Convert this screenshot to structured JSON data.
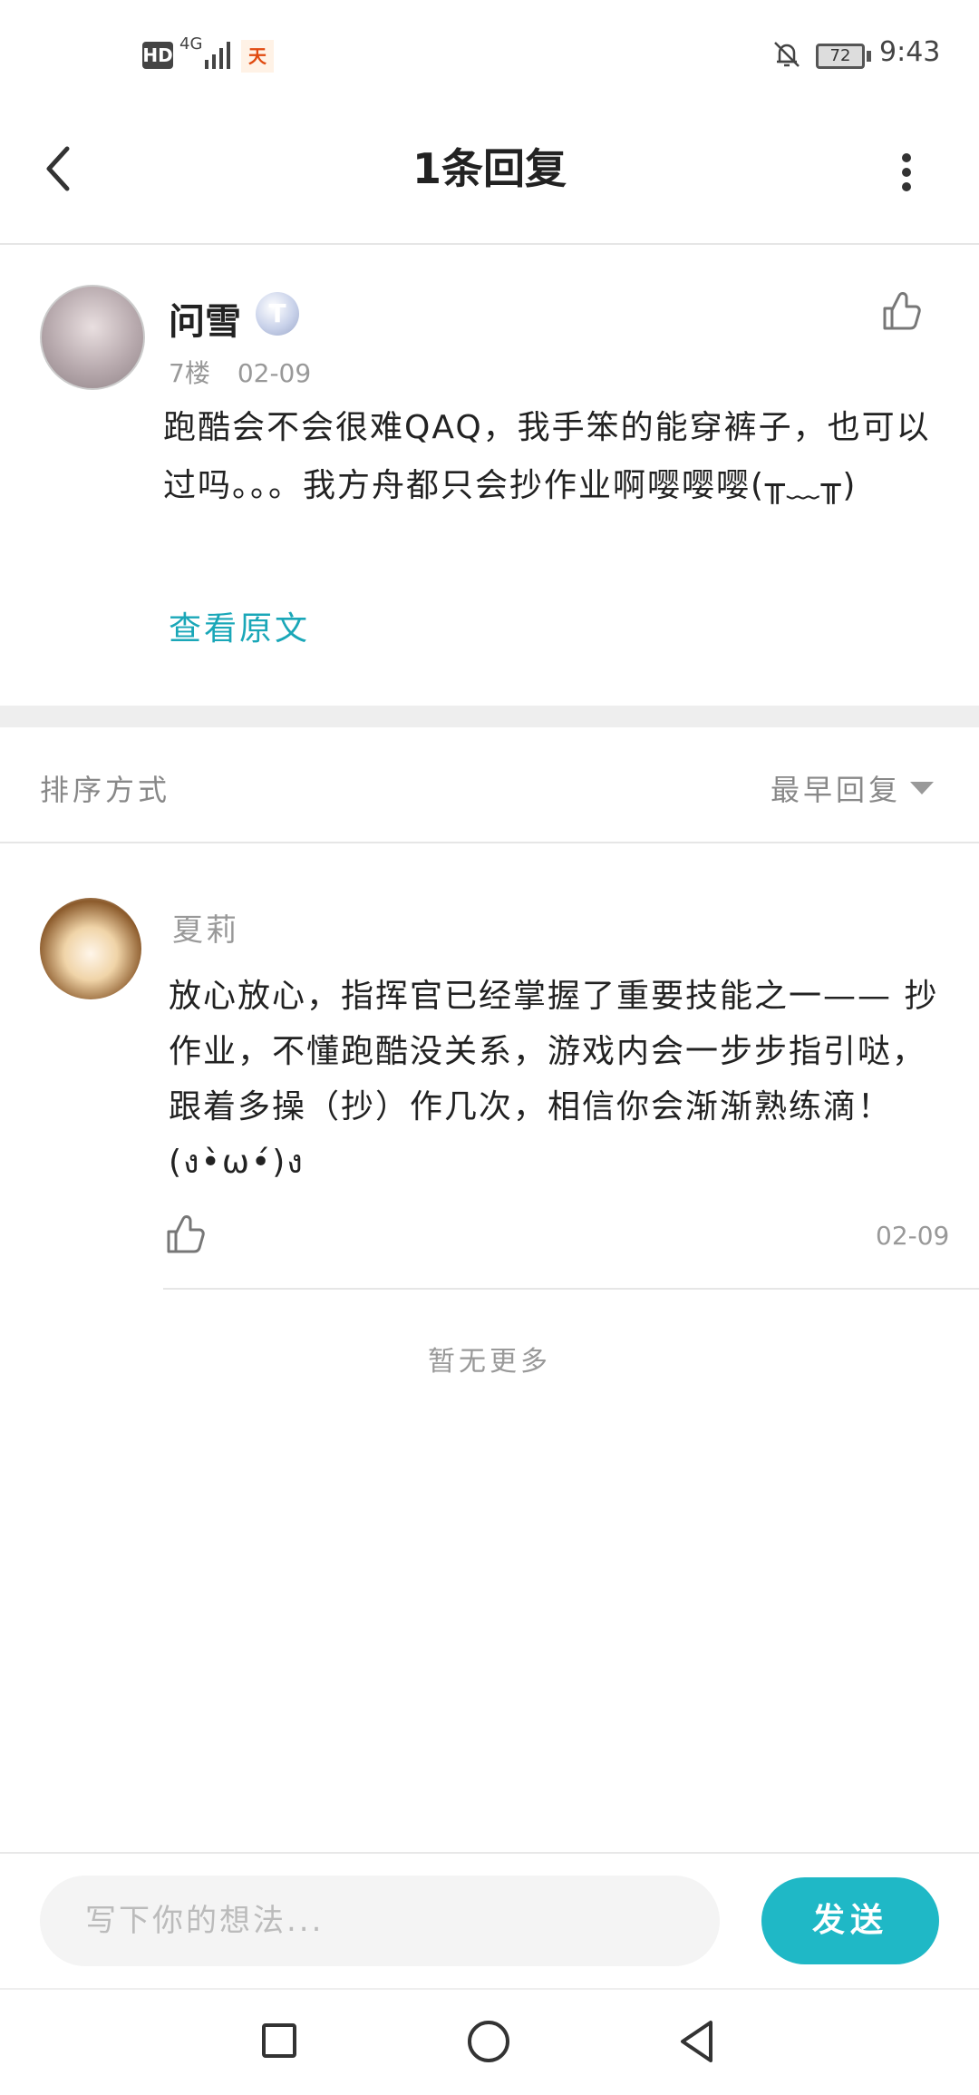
{
  "status_bar": {
    "hd": "HD",
    "network": "4G",
    "carrier_icon": "天",
    "battery": "72",
    "time": "9:43"
  },
  "header": {
    "title": "1条回复"
  },
  "post": {
    "username": "问雪",
    "level_badge": "T",
    "floor": "7楼",
    "date": "02-09",
    "body": "跑酷会不会很难QAQ，我手笨的能穿裤子，也可以过吗。。。我方舟都只会抄作业啊嘤嘤嘤(╥﹏╥)",
    "view_original": "查看原文"
  },
  "sort": {
    "label": "排序方式",
    "value": "最早回复"
  },
  "reply": {
    "username": "夏莉",
    "body": "放心放心，指挥官已经掌握了重要技能之一—— 抄作业，不懂跑酷没关系，游戏内会一步步指引哒，跟着多操（抄）作几次，相信你会渐渐熟练滴！(ง•̀ω•́)ง",
    "date": "02-09"
  },
  "no_more": "暂无更多",
  "input": {
    "placeholder": "写下你的想法...",
    "send_label": "发送"
  },
  "colors": {
    "accent": "#1fb8c6",
    "link": "#1aa7b8"
  }
}
